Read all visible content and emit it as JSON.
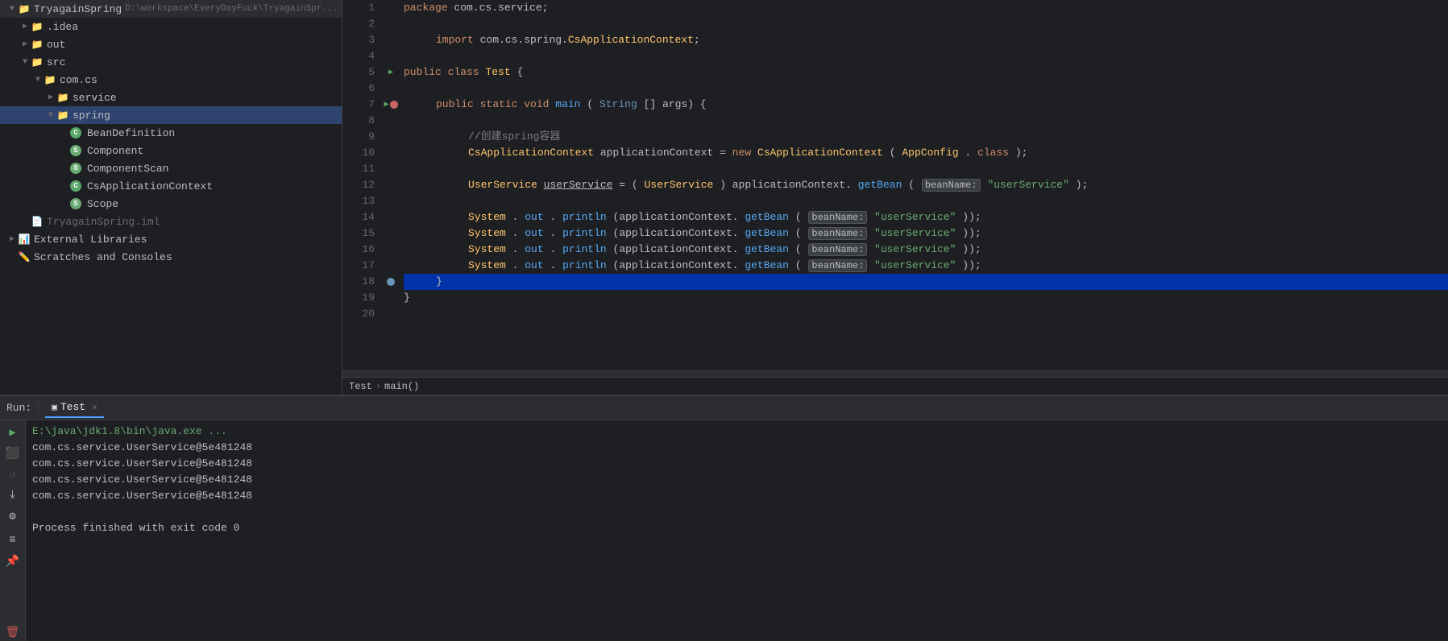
{
  "sidebar": {
    "items": [
      {
        "id": "tryagainspring",
        "label": "TryagainSpring",
        "path": "D:\\workspace\\EveryDayFuck\\TryagainSpr...",
        "indent": "indent-1",
        "arrow": "open",
        "icon": "folder"
      },
      {
        "id": "idea",
        "label": ".idea",
        "indent": "indent-2",
        "arrow": "closed",
        "icon": "folder"
      },
      {
        "id": "out",
        "label": "out",
        "indent": "indent-2",
        "arrow": "closed",
        "icon": "folder"
      },
      {
        "id": "src",
        "label": "src",
        "indent": "indent-2",
        "arrow": "open",
        "icon": "folder-src"
      },
      {
        "id": "com.cs",
        "label": "com.cs",
        "indent": "indent-3",
        "arrow": "open",
        "icon": "folder"
      },
      {
        "id": "service",
        "label": "service",
        "indent": "indent-4",
        "arrow": "closed",
        "icon": "folder"
      },
      {
        "id": "spring",
        "label": "spring",
        "indent": "indent-4",
        "arrow": "open",
        "icon": "folder",
        "selected": true
      },
      {
        "id": "beandefinition",
        "label": "BeanDefinition",
        "indent": "indent-5",
        "arrow": "none",
        "icon": "java-class"
      },
      {
        "id": "component",
        "label": "Component",
        "indent": "indent-5",
        "arrow": "none",
        "icon": "spring"
      },
      {
        "id": "componentscan",
        "label": "ComponentScan",
        "indent": "indent-5",
        "arrow": "none",
        "icon": "spring"
      },
      {
        "id": "csapplicationcontext",
        "label": "CsApplicationContext",
        "indent": "indent-5",
        "arrow": "none",
        "icon": "java-class"
      },
      {
        "id": "scope",
        "label": "Scope",
        "indent": "indent-5",
        "arrow": "none",
        "icon": "spring"
      },
      {
        "id": "tryagainspring-iml",
        "label": "TryagainSpring.iml",
        "indent": "indent-2",
        "arrow": "none",
        "icon": "iml"
      },
      {
        "id": "external-libraries",
        "label": "External Libraries",
        "indent": "indent-1",
        "arrow": "closed",
        "icon": "external"
      },
      {
        "id": "scratches",
        "label": "Scratches and Consoles",
        "indent": "indent-1",
        "arrow": "none",
        "icon": "external"
      }
    ]
  },
  "editor": {
    "lines": [
      {
        "num": 1,
        "content": "package_com.cs.service;",
        "type": "package"
      },
      {
        "num": 2,
        "content": "",
        "type": "blank"
      },
      {
        "num": 3,
        "content": "import_com.cs.spring.CsApplicationContext;",
        "type": "import"
      },
      {
        "num": 4,
        "content": "",
        "type": "blank"
      },
      {
        "num": 5,
        "content": "public_class_Test_{",
        "type": "class-decl",
        "run": true
      },
      {
        "num": 6,
        "content": "",
        "type": "blank"
      },
      {
        "num": 7,
        "content": "public_static_void_main(String[]_args)_{",
        "type": "method-decl",
        "run": true,
        "bp": true
      },
      {
        "num": 8,
        "content": "",
        "type": "blank"
      },
      {
        "num": 9,
        "content": "//创建spring容器",
        "type": "comment"
      },
      {
        "num": 10,
        "content": "CsApplicationContext_applicationContext_=_new_CsApplicationContext(AppConfig.class);",
        "type": "code"
      },
      {
        "num": 11,
        "content": "",
        "type": "blank"
      },
      {
        "num": 12,
        "content": "UserService_userService_=_(UserService)_applicationContext.getBean(beanName:_\"userService\");",
        "type": "code-hint"
      },
      {
        "num": 13,
        "content": "",
        "type": "blank"
      },
      {
        "num": 14,
        "content": "System.out.println(applicationContext.getBean(beanName:_\"userService\"));",
        "type": "code-hint"
      },
      {
        "num": 15,
        "content": "System.out.println(applicationContext.getBean(beanName:_\"userService\"));",
        "type": "code-hint"
      },
      {
        "num": 16,
        "content": "System.out.println(applicationContext.getBean(beanName:_\"userService\"));",
        "type": "code-hint"
      },
      {
        "num": 17,
        "content": "System.out.println(applicationContext.getBean(beanName:_\"userService\"));",
        "type": "code-hint"
      },
      {
        "num": 18,
        "content": "    }",
        "type": "closing-brace",
        "highlight": true,
        "bp": true
      },
      {
        "num": 19,
        "content": "}",
        "type": "closing-brace-2"
      },
      {
        "num": 20,
        "content": "",
        "type": "blank"
      }
    ]
  },
  "breadcrumb": {
    "items": [
      "Test",
      "main()"
    ]
  },
  "run_panel": {
    "label": "Run:",
    "tab": "Test",
    "output_lines": [
      {
        "text": "E:\\java\\jdk1.8\\bin\\java.exe ...",
        "type": "java-exe"
      },
      {
        "text": "com.cs.service.UserService@5e481248",
        "type": "normal"
      },
      {
        "text": "com.cs.service.UserService@5e481248",
        "type": "normal"
      },
      {
        "text": "com.cs.service.UserService@5e481248",
        "type": "normal"
      },
      {
        "text": "com.cs.service.UserService@5e481248",
        "type": "normal"
      },
      {
        "text": "",
        "type": "blank"
      },
      {
        "text": "Process finished with exit code 0",
        "type": "normal"
      }
    ]
  }
}
